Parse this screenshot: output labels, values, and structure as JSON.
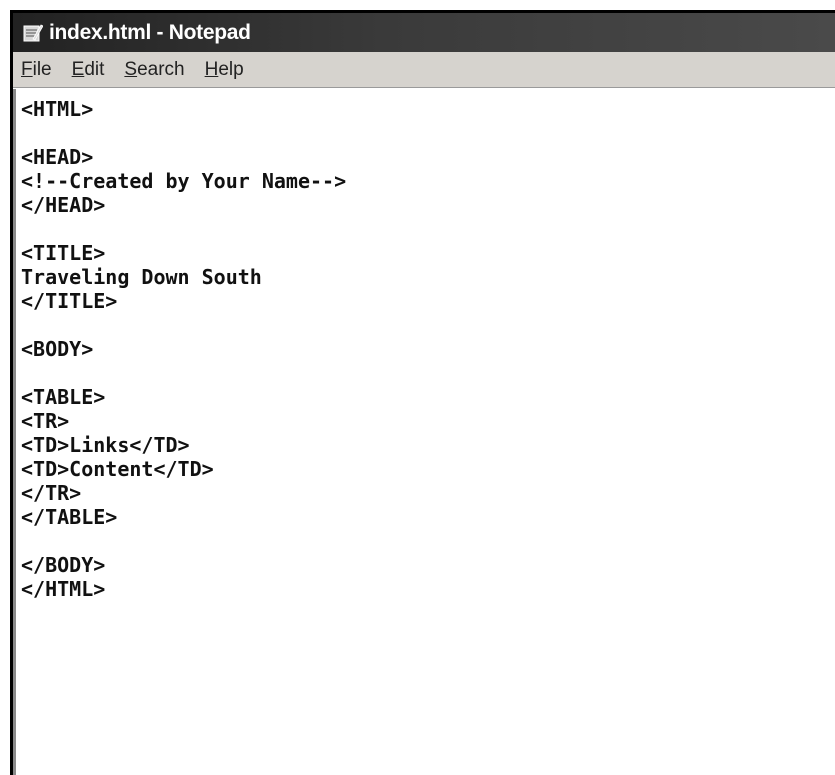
{
  "window": {
    "title": "index.html - Notepad"
  },
  "menu": {
    "items": [
      {
        "label": "File",
        "accel": "F",
        "rest": "ile"
      },
      {
        "label": "Edit",
        "accel": "E",
        "rest": "dit"
      },
      {
        "label": "Search",
        "accel": "S",
        "rest": "earch"
      },
      {
        "label": "Help",
        "accel": "H",
        "rest": "elp"
      }
    ]
  },
  "editor": {
    "lines": [
      "<HTML>",
      "",
      "<HEAD>",
      "<!--Created by Your Name-->",
      "</HEAD>",
      "",
      "<TITLE>",
      "Traveling Down South",
      "</TITLE>",
      "",
      "<BODY>",
      "",
      "<TABLE>",
      "<TR>",
      "<TD>Links</TD>",
      "<TD>Content</TD>",
      "</TR>",
      "</TABLE>",
      "",
      "</BODY>",
      "</HTML>"
    ]
  },
  "icons": {
    "app": "notepad-icon"
  }
}
